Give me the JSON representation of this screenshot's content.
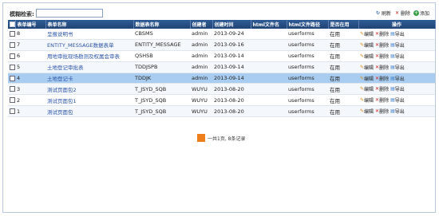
{
  "search": {
    "label": "模糊检索:",
    "value": ""
  },
  "toolbar": {
    "refresh_label": "刷新",
    "delete_label": "删除",
    "add_label": "添加"
  },
  "table": {
    "columns": [
      "表单编号",
      "表单名称",
      "数据表名称",
      "创建者",
      "创建时间",
      "html文件名",
      "html文件路径",
      "是否在用",
      "操作"
    ],
    "rows": [
      {
        "id": "8",
        "name": "呈报说明书",
        "table": "CBSMS",
        "creator": "admin",
        "created": "2013-09-24",
        "html_name": "",
        "html_path": "userforms",
        "in_use": "在用"
      },
      {
        "id": "7",
        "name": "ENTITY_MESSAGE数据表单",
        "table": "ENTITY_MESSAGE",
        "creator": "admin",
        "created": "2013-09-16",
        "html_name": "",
        "html_path": "userforms",
        "in_use": "在用"
      },
      {
        "id": "6",
        "name": "用地审批现场勘测及权属会审表",
        "table": "QSHSB",
        "creator": "admin",
        "created": "2013-09-14",
        "html_name": "",
        "html_path": "userforms",
        "in_use": "在用"
      },
      {
        "id": "5",
        "name": "土地登记审批表",
        "table": "TDDJSPB",
        "creator": "admin",
        "created": "2013-09-14",
        "html_name": "",
        "html_path": "userforms",
        "in_use": "在用"
      },
      {
        "id": "4",
        "name": "土地登记卡",
        "table": "TDDJK",
        "creator": "admin",
        "created": "2013-09-14",
        "html_name": "",
        "html_path": "userforms",
        "in_use": "在用"
      },
      {
        "id": "3",
        "name": "测试页面包2",
        "table": "T_JSYD_SQB",
        "creator": "WUYU",
        "created": "2013-08-20",
        "html_name": "",
        "html_path": "userforms",
        "in_use": "在用"
      },
      {
        "id": "2",
        "name": "测试页面包1",
        "table": "T_JSYD_SQB",
        "creator": "WUYU",
        "created": "2013-08-20",
        "html_name": "",
        "html_path": "userforms",
        "in_use": "在用"
      },
      {
        "id": "1",
        "name": "测试页面包",
        "table": "T_JSYD_SQB",
        "creator": "WUYU",
        "created": "2013-08-20",
        "html_name": "",
        "html_path": "userforms",
        "in_use": "在用"
      }
    ],
    "ops": {
      "edit": "编辑",
      "delete": "删除",
      "export": "导出"
    }
  },
  "pager": {
    "text": "一共1页, 8条记录"
  },
  "colors": {
    "header": "#204475",
    "selected_row": "#a9cdf0",
    "link": "#2c54a8"
  },
  "icons": [
    "refresh-icon",
    "delete-icon",
    "add-icon",
    "edit-icon",
    "export-icon"
  ]
}
